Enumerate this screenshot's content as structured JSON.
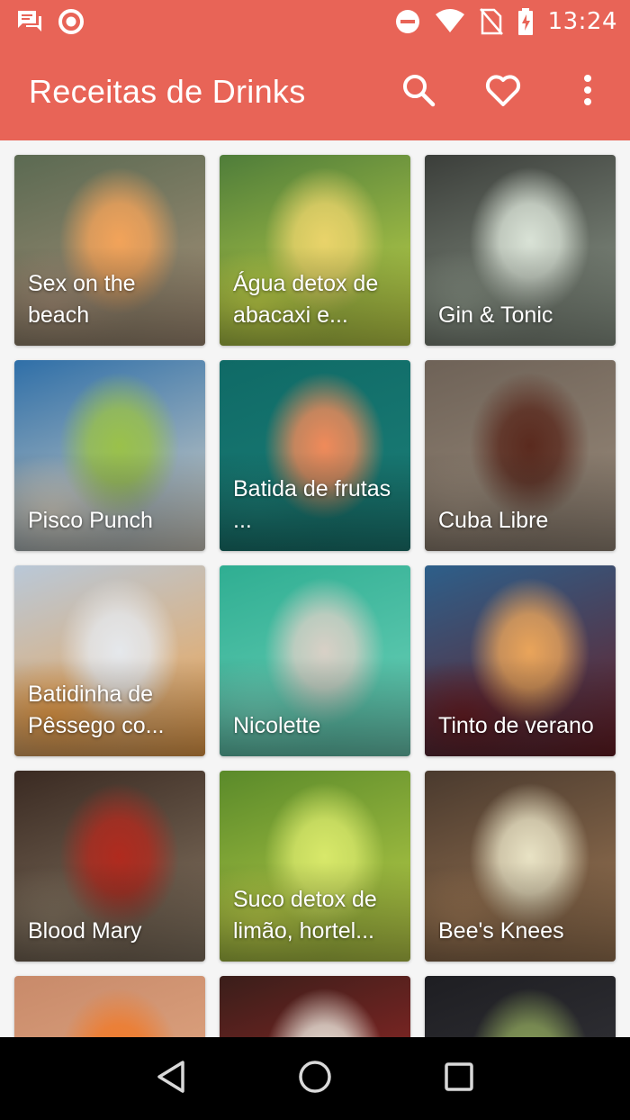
{
  "status_bar": {
    "time": "13:24",
    "icons": [
      "chat-notification-icon",
      "circle-notification-icon",
      "do-not-disturb-icon",
      "wifi-icon",
      "no-sim-icon",
      "battery-charging-icon"
    ]
  },
  "app_bar": {
    "title": "Receitas de Drinks",
    "actions": [
      "search-icon",
      "heart-icon",
      "more-vert-icon"
    ]
  },
  "drinks": [
    {
      "name": "Sex on the beach",
      "colors": [
        "#5b6a52",
        "#a9927a",
        "#f2a35a"
      ]
    },
    {
      "name": "Água detox de abacaxi e...",
      "colors": [
        "#4f7d3a",
        "#c7d94a",
        "#e9d36a"
      ]
    },
    {
      "name": "Gin & Tonic",
      "colors": [
        "#3b3e3a",
        "#8f9a8c",
        "#d9e2d6"
      ]
    },
    {
      "name": "Pisco Punch",
      "colors": [
        "#2f6fa8",
        "#d8d4c8",
        "#9ac14a"
      ]
    },
    {
      "name": "Batida de frutas ...",
      "colors": [
        "#0f6a66",
        "#1c7f78",
        "#f08a5a"
      ]
    },
    {
      "name": "Cuba Libre",
      "colors": [
        "#6e6257",
        "#9b8c7c",
        "#5a2a1e"
      ]
    },
    {
      "name": "Batidinha de Pêssego co...",
      "colors": [
        "#b9c8d8",
        "#f0a24a",
        "#e5e8ec"
      ]
    },
    {
      "name": "Nicolette",
      "colors": [
        "#2fae92",
        "#6fd2ba",
        "#d8d0c6"
      ]
    },
    {
      "name": "Tinto de verano",
      "colors": [
        "#2d5f8a",
        "#6a1e24",
        "#e9a45a"
      ]
    },
    {
      "name": "Blood Mary",
      "colors": [
        "#3a2a22",
        "#8a7a66",
        "#b02a1e"
      ]
    },
    {
      "name": "Suco detox de limão, hortel...",
      "colors": [
        "#5a8a2a",
        "#bfd24a",
        "#d8e86a"
      ]
    },
    {
      "name": "Bee's Knees",
      "colors": [
        "#4a3a2e",
        "#a07a56",
        "#e8e2c4"
      ]
    },
    {
      "name": "",
      "colors": [
        "#c88a6a",
        "#e8b08a",
        "#f07a2a"
      ]
    },
    {
      "name": "",
      "colors": [
        "#3a1e1a",
        "#b02a2a",
        "#e8e2d8"
      ]
    },
    {
      "name": "",
      "colors": [
        "#1e1e22",
        "#3a3a40",
        "#8aa05a"
      ]
    }
  ],
  "nav_bar": {
    "buttons": [
      "back-icon",
      "home-icon",
      "recents-icon"
    ]
  }
}
